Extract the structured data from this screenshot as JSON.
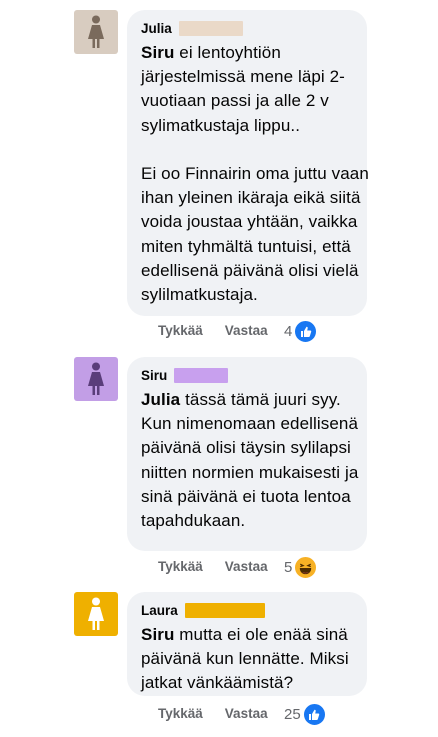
{
  "comments": [
    {
      "author": "Julia",
      "avatar_icon": "female-person-icon",
      "avatar_color": "#d8ccc0",
      "redact_color": "#ead9c8",
      "mention": "Siru",
      "text": " ei lentoyhtiön järjestelmissä mene läpi 2-vuotiaan passi ja alle 2 v sylimatkustaja lippu..\n\nEi oo Finnairin oma juttu vaan ihan yleinen ikäraja eikä siitä voida joustaa yhtään, vaikka miten tyhmältä tuntuisi, että edellisenä päivänä olisi vielä sylilmatkustaja.",
      "like_label": "Tykkää",
      "reply_label": "Vastaa",
      "reaction_count": "4",
      "reaction_icon": "like-icon"
    },
    {
      "author": "Siru",
      "avatar_icon": "female-person-icon",
      "avatar_color": "#c29ee6",
      "redact_color": "#c8a0ee",
      "mention": "Julia",
      "text": " tässä tämä juuri syy. Kun nimenomaan edellisenä päivänä olisi täysin sylilapsi niitten normien mukaisesti ja sinä päivänä ei tuota lentoa tapahdukaan.",
      "like_label": "Tykkää",
      "reply_label": "Vastaa",
      "reaction_count": "5",
      "reaction_icon": "haha-icon"
    },
    {
      "author": "Laura",
      "avatar_icon": "female-person-icon",
      "avatar_color": "#efb000",
      "redact_color": "#efb000",
      "mention": "Siru",
      "text": " mutta ei ole enää sinä päivänä kun lennätte. Miksi jatkat vänkäämistä?",
      "like_label": "Tykkää",
      "reply_label": "Vastaa",
      "reaction_count": "25",
      "reaction_icon": "like-icon"
    }
  ]
}
